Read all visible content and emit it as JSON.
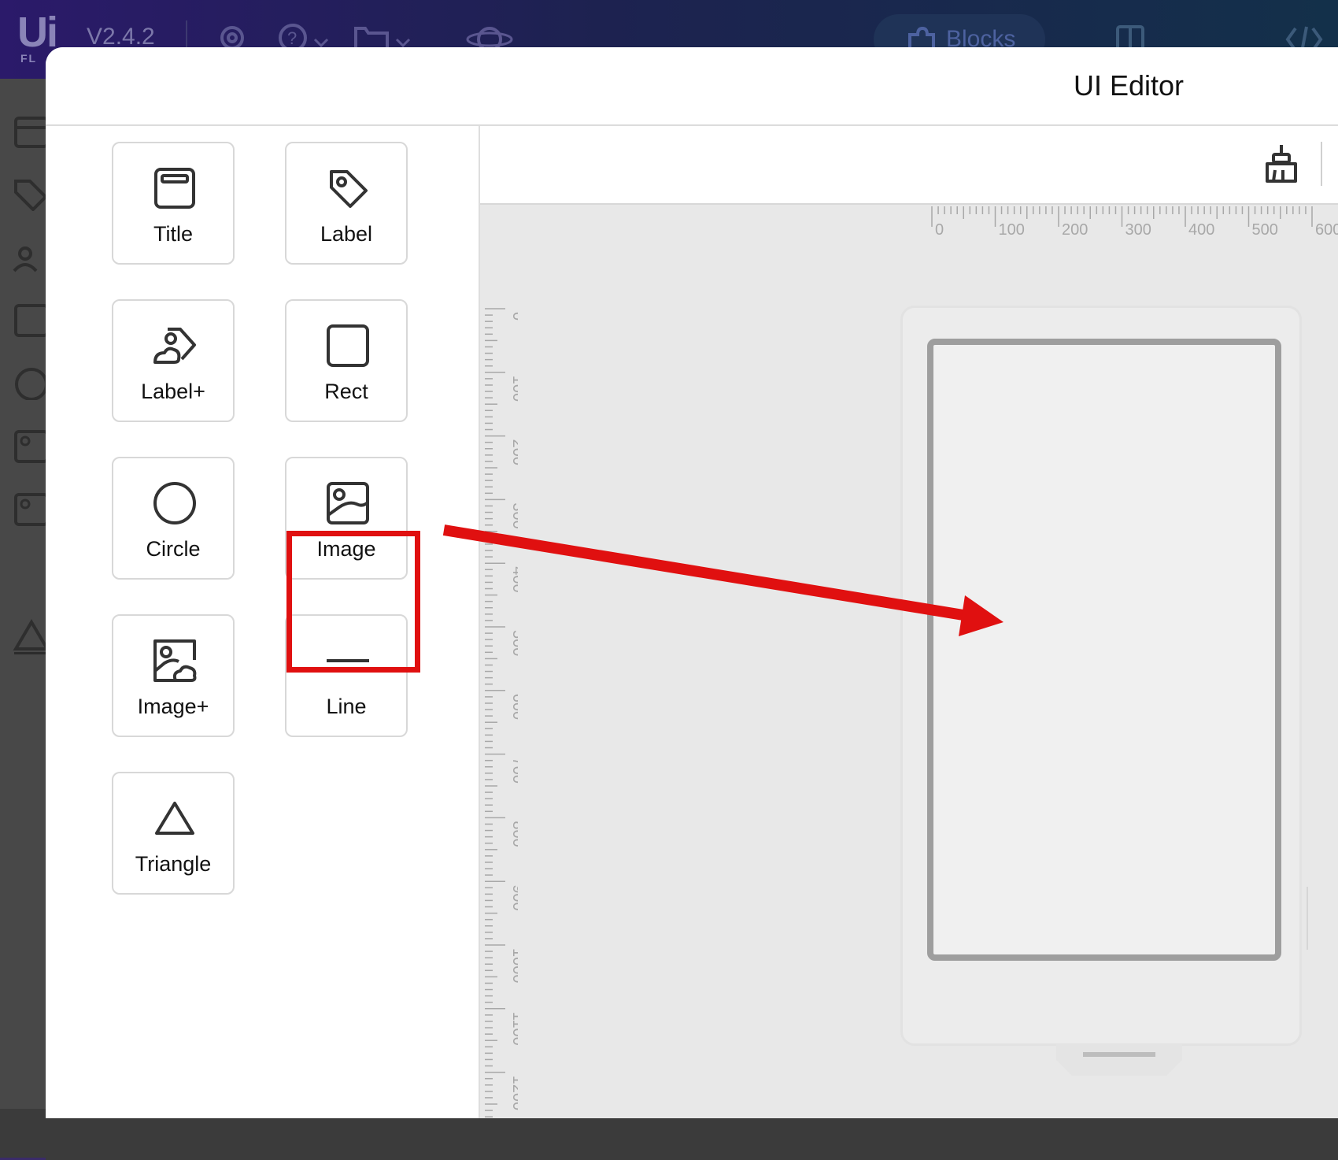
{
  "app": {
    "logo": "Ui",
    "logo_sub": "FL",
    "version": "V2.4.2",
    "blocks_tab": "Blocks"
  },
  "modal": {
    "title": "UI Editor"
  },
  "palette": {
    "items": [
      {
        "label": "Title",
        "icon": "title-window-icon"
      },
      {
        "label": "Label",
        "icon": "tag-icon"
      },
      {
        "label": "Label+",
        "icon": "label-plus-icon"
      },
      {
        "label": "Rect",
        "icon": "rect-icon"
      },
      {
        "label": "Circle",
        "icon": "circle-icon"
      },
      {
        "label": "Image",
        "icon": "image-icon"
      },
      {
        "label": "Image+",
        "icon": "image-plus-icon"
      },
      {
        "label": "Line",
        "icon": "line-icon"
      },
      {
        "label": "Triangle",
        "icon": "triangle-icon"
      }
    ],
    "highlighted": "Image"
  },
  "rulers": {
    "horizontal": [
      "0",
      "100",
      "200",
      "300",
      "400",
      "500",
      "600"
    ],
    "vertical": [
      "0",
      "100",
      "200",
      "300",
      "400",
      "500",
      "600",
      "700",
      "800",
      "900",
      "1000",
      "1100",
      "1200"
    ]
  },
  "colors": {
    "highlight": "#e01010",
    "arrow": "#e01010",
    "topbar": "#1d2250"
  }
}
